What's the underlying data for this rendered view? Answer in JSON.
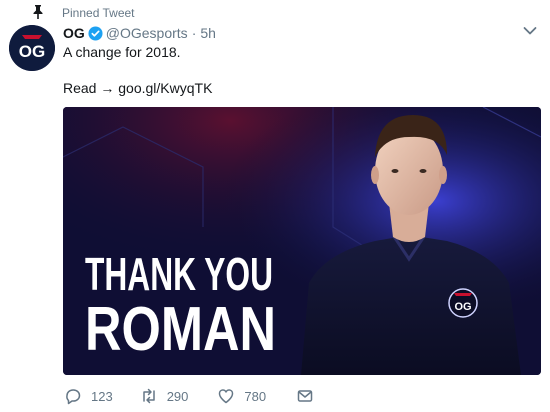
{
  "pinned_label": "Pinned Tweet",
  "author": {
    "name": "OG",
    "handle": "@OGesports",
    "time": "5h",
    "verified": true,
    "avatar_text": "OG"
  },
  "tweet": {
    "text_line1": "A change for 2018.",
    "text_line2": "Read → goo.gl/KwyqTK"
  },
  "media": {
    "headline_line1": "THANK YOU",
    "headline_line2": "ROMAN",
    "jersey_logo": "OG",
    "description": ""
  },
  "actions": {
    "reply_count": "123",
    "retweet_count": "290",
    "like_count": "780"
  },
  "colors": {
    "link": "#1da1f2",
    "secondary_text": "#657786",
    "verified": "#1da1f2",
    "media_bg": "#0f0e34"
  }
}
